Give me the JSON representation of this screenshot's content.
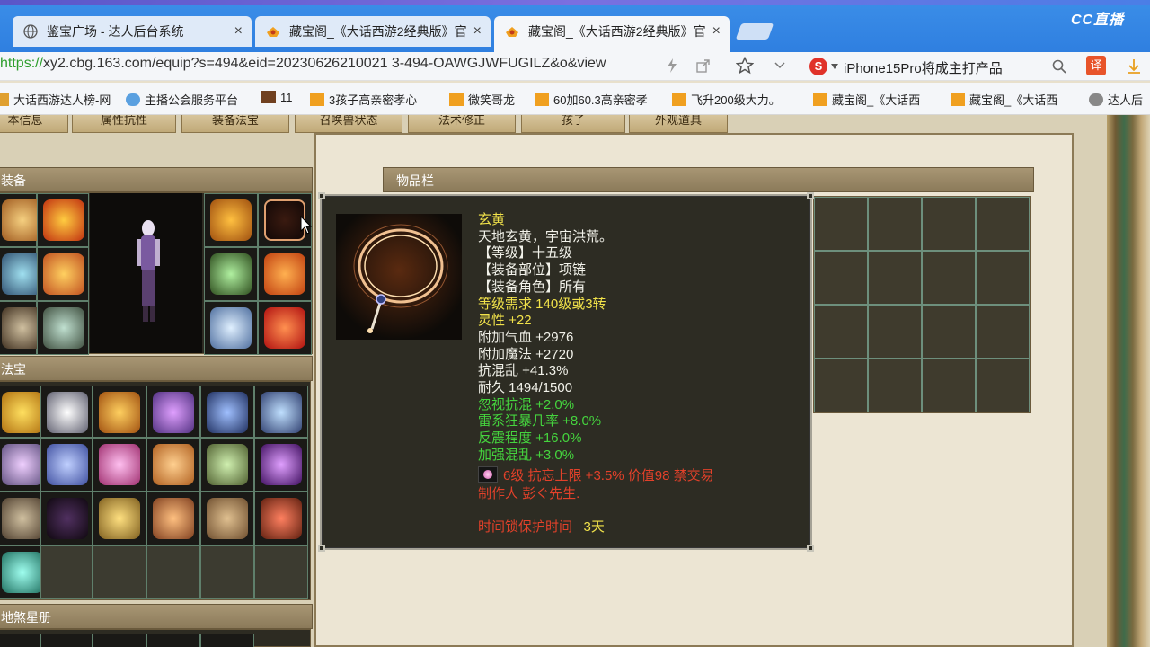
{
  "browser": {
    "tabs": [
      {
        "title": "鉴宝广场 - 达人后台系统"
      },
      {
        "title": "藏宝阁_《大话西游2经典版》官"
      },
      {
        "title": "藏宝阁_《大话西游2经典版》官"
      }
    ],
    "close_glyph": "×",
    "brand": "CC直播",
    "url_proto": "https://",
    "url_rest": "xy2.cbg.163.com/equip?s=494&eid=20230626210021 3-494-OAWGJWFUGILZ&o&view",
    "search_text": "iPhone15Pro将成主打产品",
    "search_logo": "S",
    "translate_label": "译",
    "bookmarks": [
      "大话西游达人榜-网",
      "主播公会服务平台",
      "11",
      "3孩子高亲密孝心",
      "微笑哥龙",
      "60加60.3高亲密孝",
      "飞升200级大力。",
      "藏宝阁_《大话西",
      "藏宝阁_《大话西",
      "达人后"
    ]
  },
  "nav_tabs": [
    "本信息",
    "属性抗性",
    "装备法宝",
    "召唤兽状态",
    "法术修正",
    "孩子",
    "外观道具"
  ],
  "panels": {
    "equipment": "装备",
    "fabao": "法宝",
    "star_book": "地煞星册",
    "item_bar": "物品栏"
  },
  "tooltip": {
    "name": "玄黄",
    "desc": "天地玄黄，宇宙洪荒。",
    "level": "【等级】十五级",
    "slot": "【装备部位】项链",
    "role": "【装备角色】所有",
    "req": "等级需求 140级或3转",
    "stats_white": [
      "灵性 +22",
      "附加气血 +2976",
      "附加魔法 +2720",
      "抗混乱 +41.3%",
      "耐久 1494/1500"
    ],
    "stats_green": [
      "忽视抗混 +2.0%",
      "雷系狂暴几率 +8.0%",
      "反震程度 +16.0%",
      "加强混乱 +3.0%"
    ],
    "gem_line": "6级 抗忘上限 +3.5% 价值98 禁交易",
    "maker": "制作人 彭ぐ先生.",
    "protect_label": "时间锁保护时间",
    "protect_value": "3天"
  },
  "colors": {
    "accent_yellow": "#f1e24a",
    "stat_green": "#45d43e",
    "warn_red": "#e2412a"
  }
}
